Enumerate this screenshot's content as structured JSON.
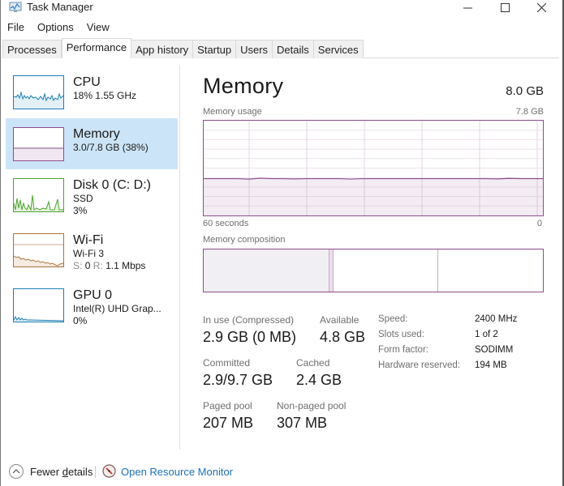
{
  "window": {
    "title": "Task Manager",
    "controls": {
      "minimize": "minimize",
      "maximize": "maximize",
      "close": "close"
    }
  },
  "menu": [
    "File",
    "Options",
    "View"
  ],
  "tabs": [
    {
      "label": "Processes",
      "active": false
    },
    {
      "label": "Performance",
      "active": true
    },
    {
      "label": "App history",
      "active": false
    },
    {
      "label": "Startup",
      "active": false
    },
    {
      "label": "Users",
      "active": false
    },
    {
      "label": "Details",
      "active": false
    },
    {
      "label": "Services",
      "active": false
    }
  ],
  "sidebar": {
    "items": [
      {
        "name": "CPU",
        "lines": [
          "18% 1.55 GHz"
        ],
        "color": "#1c7fb4",
        "selected": false
      },
      {
        "name": "Memory",
        "lines": [
          "3.0/7.8 GB (38%)"
        ],
        "color": "#8b4d8b",
        "selected": true
      },
      {
        "name": "Disk 0 (C: D:)",
        "lines": [
          "SSD",
          "3%"
        ],
        "color": "#4da32e",
        "selected": false
      },
      {
        "name": "Wi-Fi",
        "lines": [
          "Wi-Fi 3"
        ],
        "wifi_rate": {
          "s_label": "S:",
          "s_value": "0",
          "r_label": "R:",
          "r_value": "1.1 Mbps"
        },
        "color": "#a7743e",
        "selected": false
      },
      {
        "name": "GPU 0",
        "lines": [
          "Intel(R) UHD Grap...",
          "0%"
        ],
        "color": "#1c7fb4",
        "selected": false
      }
    ]
  },
  "main": {
    "title": "Memory",
    "total": "8.0 GB",
    "usage_label": "Memory usage",
    "usage_max": "7.8 GB",
    "axis_left": "60 seconds",
    "axis_right": "0",
    "composition_label": "Memory composition",
    "usage_fraction": 0.38,
    "composition": {
      "in_use_fraction": 0.37,
      "modified_fraction": 0.012,
      "standby_fraction": 0.31,
      "free_fraction": 0.308
    },
    "accent": "#8b4d8b"
  },
  "stats": {
    "in_use": {
      "label": "In use (Compressed)",
      "value": "2.9 GB (0 MB)"
    },
    "available": {
      "label": "Available",
      "value": "4.8 GB"
    },
    "committed": {
      "label": "Committed",
      "value": "2.9/9.7 GB"
    },
    "cached": {
      "label": "Cached",
      "value": "2.4 GB"
    },
    "paged_pool": {
      "label": "Paged pool",
      "value": "207 MB"
    },
    "non_paged_pool": {
      "label": "Non-paged pool",
      "value": "307 MB"
    }
  },
  "specs": [
    {
      "key": "Speed:",
      "value": "2400 MHz"
    },
    {
      "key": "Slots used:",
      "value": "1 of 2"
    },
    {
      "key": "Form factor:",
      "value": "SODIMM"
    },
    {
      "key": "Hardware reserved:",
      "value": "194 MB"
    }
  ],
  "footer": {
    "fewer_prefix": "Fewer ",
    "fewer_underlined": "d",
    "fewer_suffix": "etails",
    "resource_monitor": "Open Resource Monitor"
  }
}
